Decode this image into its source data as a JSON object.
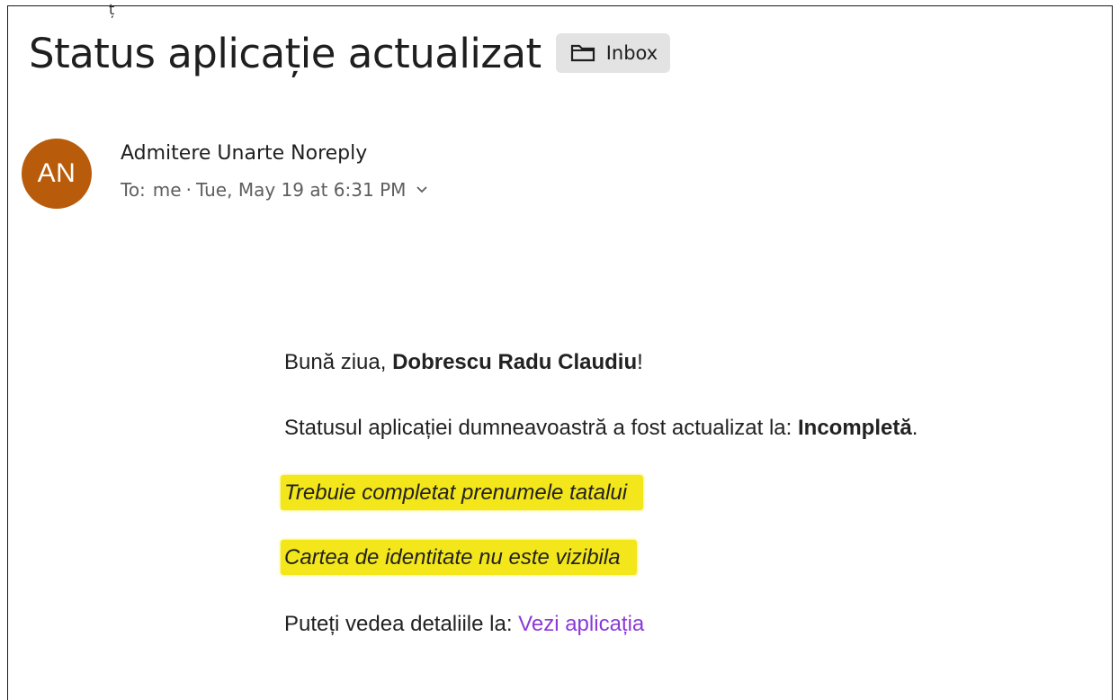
{
  "email": {
    "subject": "Status aplicație actualizat",
    "label": {
      "icon": "folder-icon",
      "text": "Inbox"
    },
    "sender": {
      "avatar_initials": "AN",
      "avatar_color": "#b85c0b",
      "name": "Admitere Unarte Noreply",
      "to_label": "To:",
      "to_value": "me",
      "separator": "·",
      "date": "Tue, May 19 at 6:31 PM"
    },
    "body": {
      "greeting_prefix": "Bună ziua, ",
      "greeting_name": "Dobrescu Radu Claudiu",
      "greeting_suffix": "!",
      "status_prefix": "Statusul aplicației dumneavoastră a fost actualizat la: ",
      "status_value": "Incompletă",
      "status_suffix": ".",
      "requirements": [
        "Trebuie completat prenumele tatalui",
        "Cartea de identitate nu este vizibila"
      ],
      "details_prefix": "Puteți vedea detaliile la: ",
      "details_link": "Vezi aplicația"
    },
    "colors": {
      "highlight": "#f3e61a",
      "link": "#8a3ad8",
      "chip_bg": "#e3e3e3"
    }
  }
}
